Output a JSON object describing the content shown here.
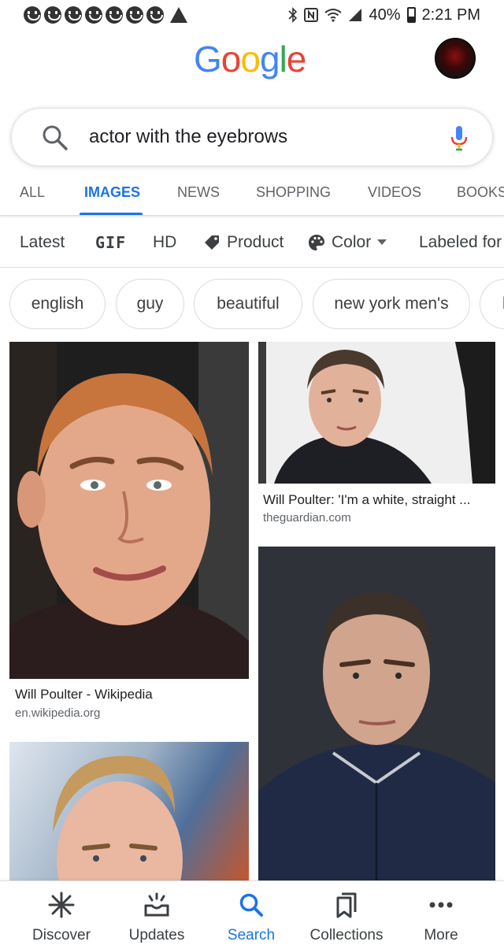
{
  "status_bar": {
    "battery": "40%",
    "time": "2:21 PM"
  },
  "header": {
    "logo": "Google"
  },
  "search": {
    "query": "actor with the eyebrows"
  },
  "tabs": [
    {
      "label": "ALL"
    },
    {
      "label": "IMAGES"
    },
    {
      "label": "NEWS"
    },
    {
      "label": "SHOPPING"
    },
    {
      "label": "VIDEOS"
    },
    {
      "label": "BOOKS"
    }
  ],
  "filters": {
    "latest": "Latest",
    "gif": "GIF",
    "hd": "HD",
    "product": "Product",
    "color": "Color",
    "labeled": "Labeled for"
  },
  "chips": [
    {
      "label": "english"
    },
    {
      "label": "guy"
    },
    {
      "label": "beautiful"
    },
    {
      "label": "new york men's"
    },
    {
      "label": "b"
    }
  ],
  "results": [
    {
      "title": "Will Poulter - Wikipedia",
      "source": "en.wikipedia.org"
    },
    {
      "title": "Will Poulter: 'I'm a white, straight ...",
      "source": "theguardian.com"
    }
  ],
  "bottom_nav": {
    "discover": "Discover",
    "updates": "Updates",
    "search": "Search",
    "collections": "Collections",
    "more": "More"
  },
  "colors": {
    "accent": "#1a73e8",
    "google_blue": "#4285F4",
    "google_red": "#EA4335",
    "google_yellow": "#FBBC05",
    "google_green": "#34A853"
  }
}
